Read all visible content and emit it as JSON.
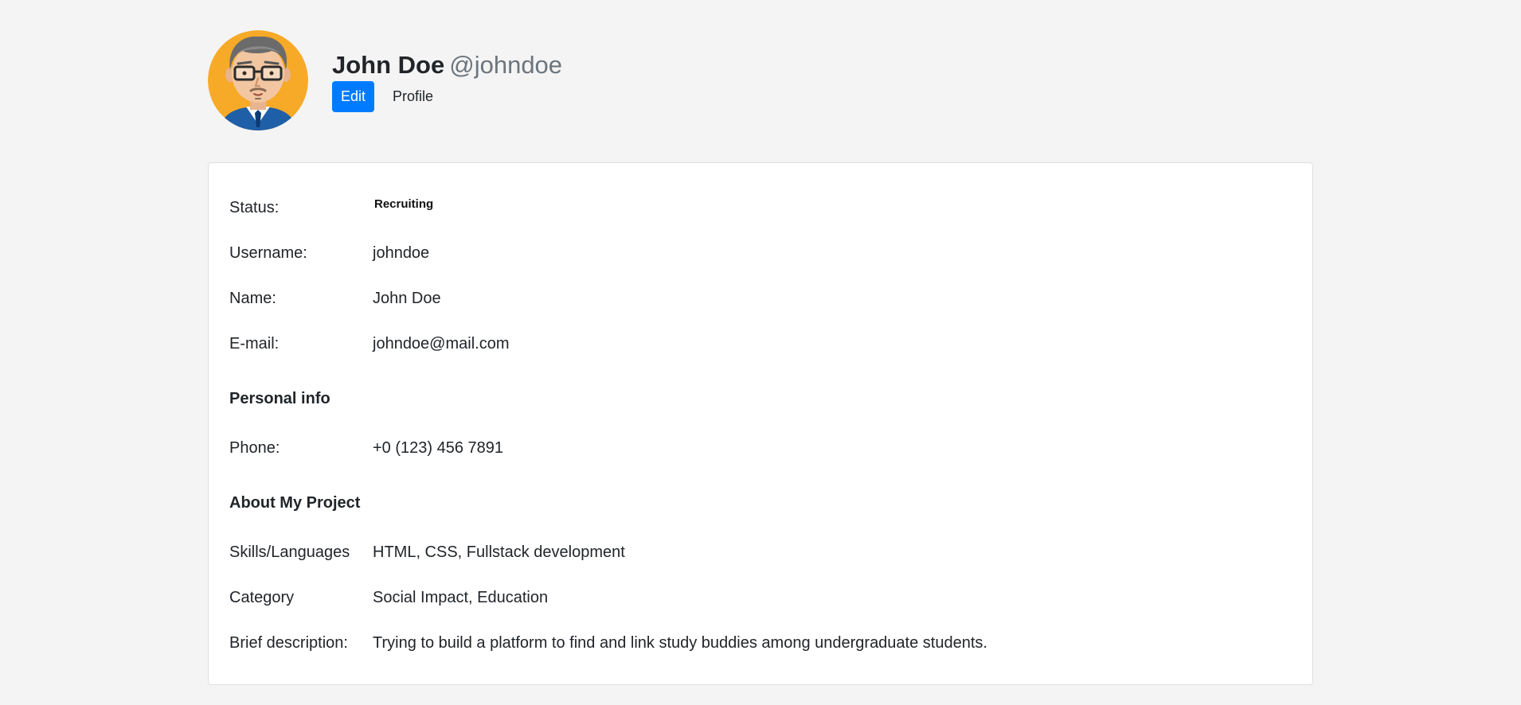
{
  "header": {
    "full_name": "John Doe",
    "handle": "@johndoe",
    "edit_label": "Edit",
    "profile_label": "Profile",
    "avatar_icon": "avatar-man-glasses"
  },
  "colors": {
    "accent": "#007bff",
    "background": "#f4f4f4",
    "card": "#ffffff",
    "avatar_bg": "#f7a928"
  },
  "account": {
    "status_label": "Status:",
    "status_value": "Recruiting",
    "username_label": "Username:",
    "username_value": "johndoe",
    "name_label": "Name:",
    "name_value": "John Doe",
    "email_label": "E-mail:",
    "email_value": "johndoe@mail.com"
  },
  "personal_info": {
    "heading": "Personal info",
    "phone_label": "Phone:",
    "phone_value": "+0 (123) 456 7891"
  },
  "project": {
    "heading": "About My Project",
    "skills_label": "Skills/Languages",
    "skills_value": "HTML, CSS, Fullstack development",
    "category_label": "Category",
    "category_value": "Social Impact, Education",
    "description_label": "Brief description:",
    "description_value": "Trying to build a platform to find and link study buddies among undergraduate students."
  }
}
